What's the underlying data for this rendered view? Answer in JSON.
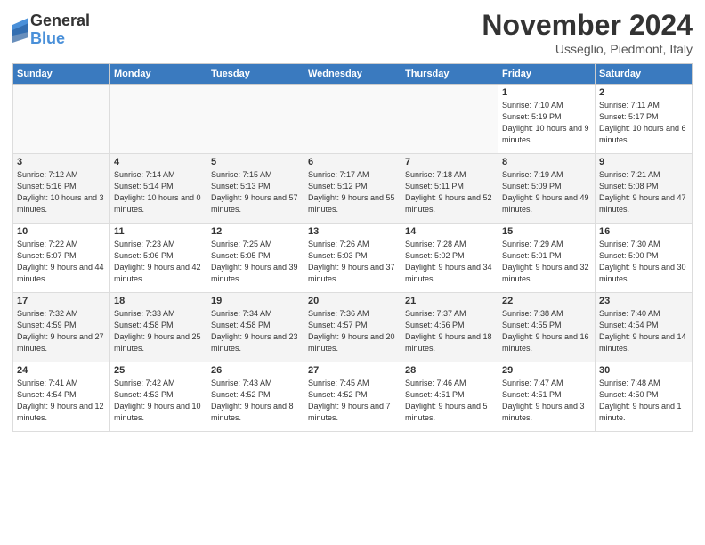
{
  "logo": {
    "general": "General",
    "blue": "Blue"
  },
  "header": {
    "month": "November 2024",
    "location": "Usseglio, Piedmont, Italy"
  },
  "weekdays": [
    "Sunday",
    "Monday",
    "Tuesday",
    "Wednesday",
    "Thursday",
    "Friday",
    "Saturday"
  ],
  "weeks": [
    [
      {
        "day": "",
        "info": ""
      },
      {
        "day": "",
        "info": ""
      },
      {
        "day": "",
        "info": ""
      },
      {
        "day": "",
        "info": ""
      },
      {
        "day": "",
        "info": ""
      },
      {
        "day": "1",
        "info": "Sunrise: 7:10 AM\nSunset: 5:19 PM\nDaylight: 10 hours and 9 minutes."
      },
      {
        "day": "2",
        "info": "Sunrise: 7:11 AM\nSunset: 5:17 PM\nDaylight: 10 hours and 6 minutes."
      }
    ],
    [
      {
        "day": "3",
        "info": "Sunrise: 7:12 AM\nSunset: 5:16 PM\nDaylight: 10 hours and 3 minutes."
      },
      {
        "day": "4",
        "info": "Sunrise: 7:14 AM\nSunset: 5:14 PM\nDaylight: 10 hours and 0 minutes."
      },
      {
        "day": "5",
        "info": "Sunrise: 7:15 AM\nSunset: 5:13 PM\nDaylight: 9 hours and 57 minutes."
      },
      {
        "day": "6",
        "info": "Sunrise: 7:17 AM\nSunset: 5:12 PM\nDaylight: 9 hours and 55 minutes."
      },
      {
        "day": "7",
        "info": "Sunrise: 7:18 AM\nSunset: 5:11 PM\nDaylight: 9 hours and 52 minutes."
      },
      {
        "day": "8",
        "info": "Sunrise: 7:19 AM\nSunset: 5:09 PM\nDaylight: 9 hours and 49 minutes."
      },
      {
        "day": "9",
        "info": "Sunrise: 7:21 AM\nSunset: 5:08 PM\nDaylight: 9 hours and 47 minutes."
      }
    ],
    [
      {
        "day": "10",
        "info": "Sunrise: 7:22 AM\nSunset: 5:07 PM\nDaylight: 9 hours and 44 minutes."
      },
      {
        "day": "11",
        "info": "Sunrise: 7:23 AM\nSunset: 5:06 PM\nDaylight: 9 hours and 42 minutes."
      },
      {
        "day": "12",
        "info": "Sunrise: 7:25 AM\nSunset: 5:05 PM\nDaylight: 9 hours and 39 minutes."
      },
      {
        "day": "13",
        "info": "Sunrise: 7:26 AM\nSunset: 5:03 PM\nDaylight: 9 hours and 37 minutes."
      },
      {
        "day": "14",
        "info": "Sunrise: 7:28 AM\nSunset: 5:02 PM\nDaylight: 9 hours and 34 minutes."
      },
      {
        "day": "15",
        "info": "Sunrise: 7:29 AM\nSunset: 5:01 PM\nDaylight: 9 hours and 32 minutes."
      },
      {
        "day": "16",
        "info": "Sunrise: 7:30 AM\nSunset: 5:00 PM\nDaylight: 9 hours and 30 minutes."
      }
    ],
    [
      {
        "day": "17",
        "info": "Sunrise: 7:32 AM\nSunset: 4:59 PM\nDaylight: 9 hours and 27 minutes."
      },
      {
        "day": "18",
        "info": "Sunrise: 7:33 AM\nSunset: 4:58 PM\nDaylight: 9 hours and 25 minutes."
      },
      {
        "day": "19",
        "info": "Sunrise: 7:34 AM\nSunset: 4:58 PM\nDaylight: 9 hours and 23 minutes."
      },
      {
        "day": "20",
        "info": "Sunrise: 7:36 AM\nSunset: 4:57 PM\nDaylight: 9 hours and 20 minutes."
      },
      {
        "day": "21",
        "info": "Sunrise: 7:37 AM\nSunset: 4:56 PM\nDaylight: 9 hours and 18 minutes."
      },
      {
        "day": "22",
        "info": "Sunrise: 7:38 AM\nSunset: 4:55 PM\nDaylight: 9 hours and 16 minutes."
      },
      {
        "day": "23",
        "info": "Sunrise: 7:40 AM\nSunset: 4:54 PM\nDaylight: 9 hours and 14 minutes."
      }
    ],
    [
      {
        "day": "24",
        "info": "Sunrise: 7:41 AM\nSunset: 4:54 PM\nDaylight: 9 hours and 12 minutes."
      },
      {
        "day": "25",
        "info": "Sunrise: 7:42 AM\nSunset: 4:53 PM\nDaylight: 9 hours and 10 minutes."
      },
      {
        "day": "26",
        "info": "Sunrise: 7:43 AM\nSunset: 4:52 PM\nDaylight: 9 hours and 8 minutes."
      },
      {
        "day": "27",
        "info": "Sunrise: 7:45 AM\nSunset: 4:52 PM\nDaylight: 9 hours and 7 minutes."
      },
      {
        "day": "28",
        "info": "Sunrise: 7:46 AM\nSunset: 4:51 PM\nDaylight: 9 hours and 5 minutes."
      },
      {
        "day": "29",
        "info": "Sunrise: 7:47 AM\nSunset: 4:51 PM\nDaylight: 9 hours and 3 minutes."
      },
      {
        "day": "30",
        "info": "Sunrise: 7:48 AM\nSunset: 4:50 PM\nDaylight: 9 hours and 1 minute."
      }
    ]
  ]
}
